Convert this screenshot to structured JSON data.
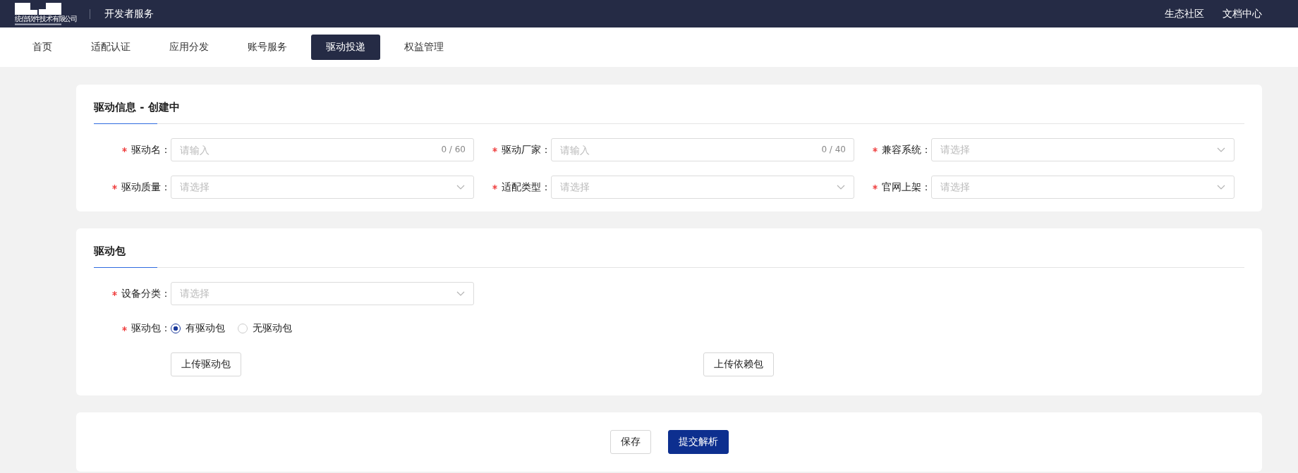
{
  "header": {
    "logo_text": "统信软件技术有限公司",
    "title": "开发者服务",
    "links": [
      "生态社区",
      "文档中心"
    ]
  },
  "tabs": [
    {
      "label": "首页",
      "selected": false
    },
    {
      "label": "适配认证",
      "selected": false
    },
    {
      "label": "应用分发",
      "selected": false
    },
    {
      "label": "账号服务",
      "selected": false
    },
    {
      "label": "驱动投递",
      "selected": true
    },
    {
      "label": "权益管理",
      "selected": false
    }
  ],
  "info_section": {
    "title": "驱动信息 - 创建中",
    "fields": [
      {
        "kind": "input",
        "label": "驱动名：",
        "required": true,
        "placeholder": "请输入",
        "counter": "0 / 60"
      },
      {
        "kind": "input",
        "label": "驱动厂家：",
        "required": true,
        "placeholder": "请输入",
        "counter": "0 / 40"
      },
      {
        "kind": "select",
        "label": "兼容系统：",
        "required": true,
        "placeholder": "请选择"
      },
      {
        "kind": "select",
        "label": "驱动质量：",
        "required": true,
        "placeholder": "请选择"
      },
      {
        "kind": "select",
        "label": "适配类型：",
        "required": true,
        "placeholder": "请选择"
      },
      {
        "kind": "select",
        "label": "官网上架：",
        "required": true,
        "placeholder": "请选择"
      }
    ]
  },
  "package_section": {
    "title": "驱动包",
    "device_field": {
      "label": "设备分类：",
      "required": true,
      "placeholder": "请选择"
    },
    "package_field": {
      "label": "驱动包：",
      "required": true,
      "options": [
        {
          "label": "有驱动包",
          "selected": true
        },
        {
          "label": "无驱动包",
          "selected": false
        }
      ]
    },
    "upload_buttons": [
      "上传驱动包",
      "上传依赖包"
    ]
  },
  "footer_buttons": [
    {
      "label": "保存",
      "kind": "default"
    },
    {
      "label": "提交解析",
      "kind": "primary"
    }
  ]
}
